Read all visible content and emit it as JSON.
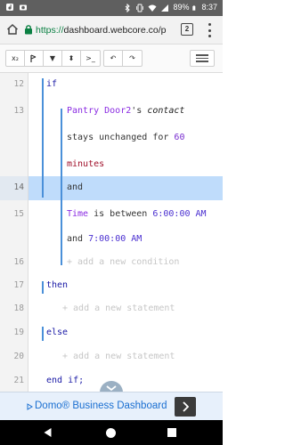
{
  "status_bar": {
    "battery": "89%",
    "time": "8:37"
  },
  "address_bar": {
    "url_scheme": "https://",
    "url_host": "dashboard.webcore.co/piston",
    "tab_count": "2"
  },
  "toolbar": {
    "btn_x2": "x₂",
    "btn_filter": "▼",
    "btn_sort": "⬍",
    "btn_console": ">_",
    "btn_undo": "↶",
    "btn_redo": "↷"
  },
  "code_lines": [
    {
      "ln": "12",
      "kw": "if"
    },
    {
      "ln": "13",
      "device": "Pantry Door2",
      "suffix": "'s ",
      "attribute": "contact"
    },
    {
      "ln": "",
      "text": "stays unchanged for ",
      "number": "60"
    },
    {
      "ln": "",
      "unit": "minutes"
    },
    {
      "ln": "14",
      "kw": "and"
    },
    {
      "ln": "15",
      "var": "Time",
      "text": " is between ",
      "time": "6:00:00 AM"
    },
    {
      "ln": "",
      "kw": "and",
      "time": "7:00:00 AM"
    },
    {
      "ln": "16",
      "add": "+ add a new condition"
    },
    {
      "ln": "17",
      "kw": "then"
    },
    {
      "ln": "18",
      "add": "+ add a new statement"
    },
    {
      "ln": "19",
      "kw": "else"
    },
    {
      "ln": "20",
      "add": "+ add a new statement"
    },
    {
      "ln": "21",
      "kw": "end if;"
    }
  ],
  "ad_banner": {
    "text": "Domo® Business Dashboard",
    "close_label": "▷"
  },
  "colors": {
    "accent_blue": "#4a90d9",
    "highlight": "#bfdcfb",
    "keyword": "#1a1aa6",
    "device": "#8a2be2",
    "unit": "#a0102a"
  }
}
